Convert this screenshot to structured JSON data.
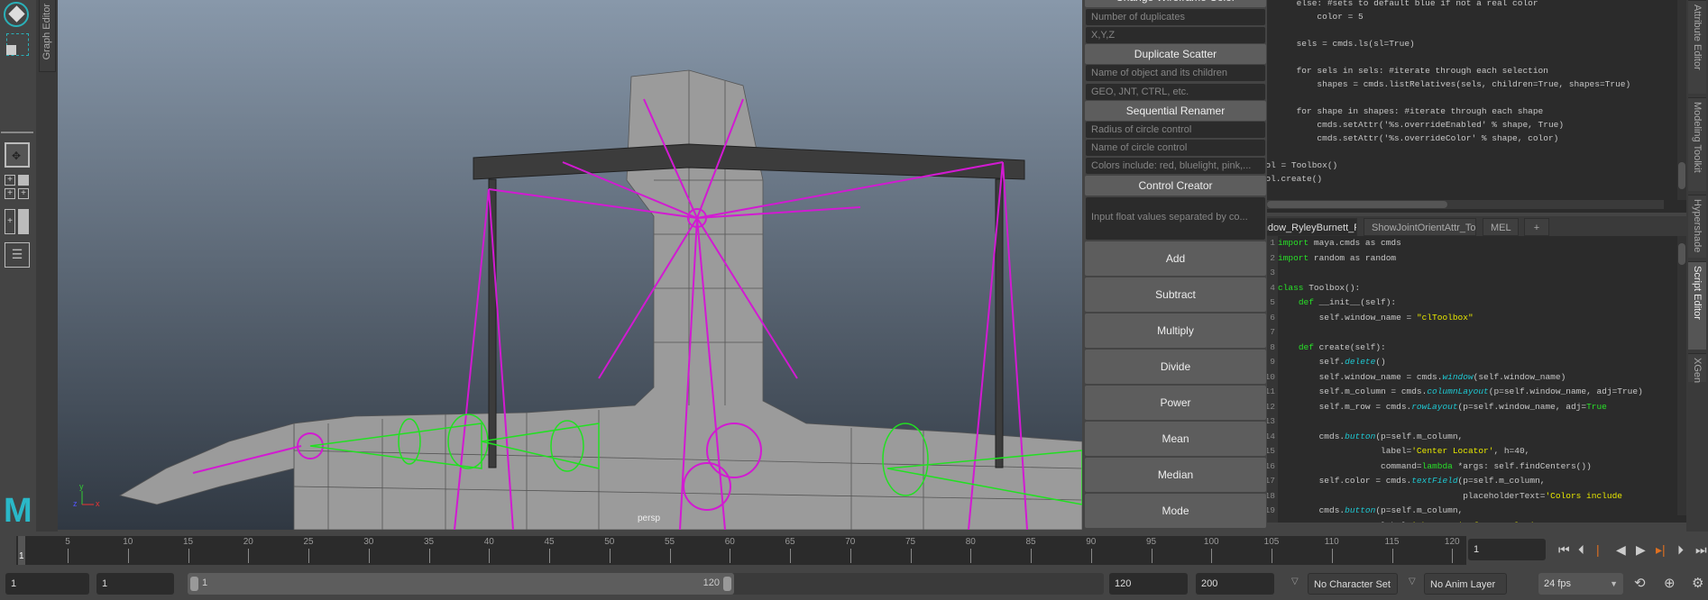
{
  "left_toolbar": {
    "graph_editor_tab": "Graph Editor"
  },
  "viewport": {
    "camera_label": "persp",
    "axis": {
      "x": "x",
      "y": "y",
      "z": "z"
    },
    "logo": "M",
    "background_top": "#8898aa",
    "background_bottom": "#303842",
    "rig_color": "#d21ad2",
    "control_color": "#22e022"
  },
  "tool_panel": {
    "partial_header": "Change Wireframe Color",
    "duplicate_count_placeholder": "Number of duplicates",
    "xyz_placeholder": "X,Y,Z",
    "duplicate_scatter": "Duplicate Scatter",
    "object_name_placeholder": "Name of object and its children",
    "suffix_placeholder": "GEO, JNT, CTRL, etc.",
    "sequential_renamer": "Sequential Renamer",
    "radius_placeholder": "Radius of circle control",
    "circle_name_placeholder": "Name of circle control",
    "colors_placeholder": "Colors include: red, bluelight, pink,...",
    "control_creator": "Control Creator",
    "float_values_placeholder": "Input float values separated by co...",
    "math_buttons": [
      "Add",
      "Subtract",
      "Multiply",
      "Divide",
      "Power",
      "Mean",
      "Median",
      "Mode"
    ]
  },
  "script_editor": {
    "history_lines": [
      "        else: #sets to default blue if not a real color",
      "            color = 5",
      "",
      "        sels = cmds.ls(sl=True)",
      "",
      "        for sels in sels: #iterate through each selection",
      "            shapes = cmds.listRelatives(sels, children=True, shapes=True)",
      "",
      "        for shape in shapes: #iterate through each shape",
      "            cmds.setAttr('%s.overrideEnabled' % shape, True)",
      "            cmds.setAttr('%s.overrideColor' % shape, color)",
      "",
      "tool = Toolbox()",
      "tool.create()"
    ],
    "tabs": [
      "ToolboxWindow_RyleyBurnett_Python.py",
      "ShowJointOrientAttr_Tool.py",
      "MEL",
      "+"
    ],
    "active_tab": 0,
    "syntax_colors": {
      "kw": "#28e028",
      "fn": "#1ec8d2",
      "str": "#e6e600",
      "plain": "#c8c8c8"
    },
    "code_lines": [
      [
        [
          "import",
          "kw"
        ],
        [
          " maya.cmds as cmds",
          "plain"
        ]
      ],
      [
        [
          "import",
          "kw"
        ],
        [
          " random as random",
          "plain"
        ]
      ],
      [],
      [
        [
          "class",
          "kw"
        ],
        [
          " Toolbox():",
          "plain"
        ]
      ],
      [
        [
          "    ",
          "plain"
        ],
        [
          "def",
          "kw"
        ],
        [
          " __init__(self):",
          "plain"
        ]
      ],
      [
        [
          "        self.window_name = ",
          "plain"
        ],
        [
          "\"clToolbox\"",
          "str"
        ]
      ],
      [],
      [
        [
          "    ",
          "plain"
        ],
        [
          "def",
          "kw"
        ],
        [
          " create(self):",
          "plain"
        ]
      ],
      [
        [
          "        self.",
          "plain"
        ],
        [
          "delete",
          "fn"
        ],
        [
          "()",
          "plain"
        ]
      ],
      [
        [
          "        self.window_name = cmds.",
          "plain"
        ],
        [
          "window",
          "fn"
        ],
        [
          "(self.window_name)",
          "plain"
        ]
      ],
      [
        [
          "        self.m_column = cmds.",
          "plain"
        ],
        [
          "columnLayout",
          "fn"
        ],
        [
          "(p=self.window_name, adj=True)",
          "plain"
        ]
      ],
      [
        [
          "        self.m_row = cmds.",
          "plain"
        ],
        [
          "rowLayout",
          "fn"
        ],
        [
          "(p=self.window_name, adj=",
          "plain"
        ],
        [
          "True",
          "kw"
        ]
      ],
      [],
      [
        [
          "        cmds.",
          "plain"
        ],
        [
          "button",
          "fn"
        ],
        [
          "(p=self.m_column,",
          "plain"
        ]
      ],
      [
        [
          "                    label=",
          "plain"
        ],
        [
          "'Center Locator'",
          "str"
        ],
        [
          ", h=40,",
          "plain"
        ]
      ],
      [
        [
          "                    command=",
          "plain"
        ],
        [
          "lambda",
          "kw"
        ],
        [
          " *args: self.findCenters())",
          "plain"
        ]
      ],
      [
        [
          "        self.color = cmds.",
          "plain"
        ],
        [
          "textField",
          "fn"
        ],
        [
          "(p=self.m_column,",
          "plain"
        ]
      ],
      [
        [
          "                                    placeholderText=",
          "plain"
        ],
        [
          "'Colors include",
          "str"
        ]
      ],
      [
        [
          "        cmds.",
          "plain"
        ],
        [
          "button",
          "fn"
        ],
        [
          "(p=self.m_column,",
          "plain"
        ]
      ],
      [
        [
          "                    label=",
          "plain"
        ],
        [
          "'Change Wireframe Color'",
          "str"
        ]
      ]
    ]
  },
  "right_tabs": [
    "Attribute Editor",
    "Modeling Toolkit",
    "Hypershade",
    "Script Editor",
    "XGen"
  ],
  "active_right_tab": "Script Editor",
  "timeline": {
    "tick_labels": [
      5,
      10,
      15,
      20,
      25,
      30,
      35,
      40,
      45,
      50,
      55,
      60,
      65,
      70,
      75,
      80,
      85,
      90,
      95,
      100,
      105,
      110,
      115,
      120
    ],
    "current_frame_marker": "1",
    "current_frame": "1",
    "playhead_color": "#e07020"
  },
  "range": {
    "start_field": "1",
    "playback_start": "1",
    "slider_start": "1",
    "slider_end": "120",
    "playback_end": "120",
    "end_field": "200",
    "character_set": "No Character Set",
    "anim_layer": "No Anim Layer",
    "fps": "24 fps"
  }
}
